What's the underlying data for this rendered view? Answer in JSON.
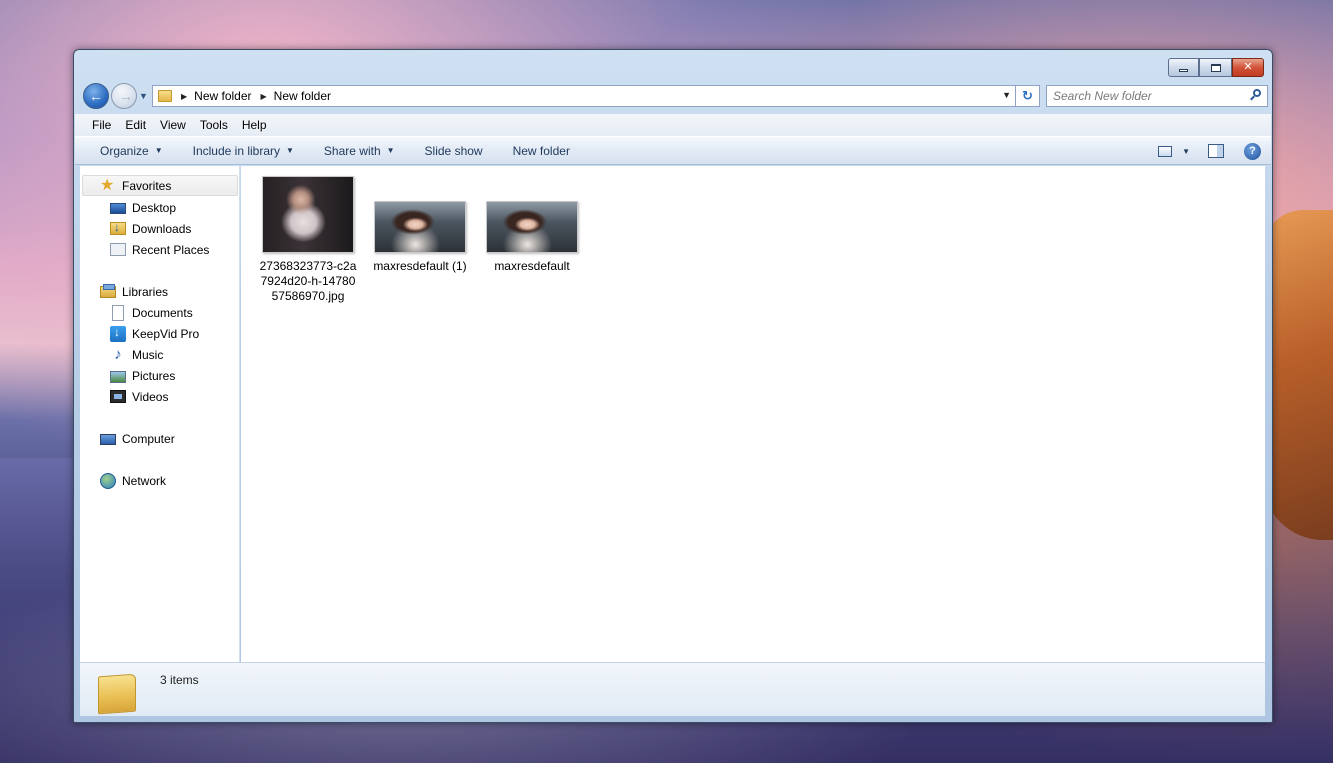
{
  "window": {
    "minimize": "",
    "maximize": "",
    "close": "✕"
  },
  "address": {
    "crumbs": [
      "New folder",
      "New folder"
    ],
    "search_placeholder": "Search New folder"
  },
  "menu": [
    "File",
    "Edit",
    "View",
    "Tools",
    "Help"
  ],
  "commands": {
    "organize": "Organize",
    "include_in_library": "Include in library",
    "share_with": "Share with",
    "slide_show": "Slide show",
    "new_folder": "New folder"
  },
  "nav": {
    "favorites": "Favorites",
    "desktop": "Desktop",
    "downloads": "Downloads",
    "recent_places": "Recent Places",
    "libraries": "Libraries",
    "documents": "Documents",
    "keepvid": "KeepVid Pro",
    "music": "Music",
    "pictures": "Pictures",
    "videos": "Videos",
    "computer": "Computer",
    "network": "Network"
  },
  "files": [
    {
      "name": "27368323773-c2a7924d20-h-1478057586970.jpg",
      "icon": "photo-portrait"
    },
    {
      "name": "maxresdefault (1)",
      "icon": "photo-wide"
    },
    {
      "name": "maxresdefault",
      "icon": "photo-wide"
    }
  ],
  "details": {
    "item_count": "3 items"
  }
}
